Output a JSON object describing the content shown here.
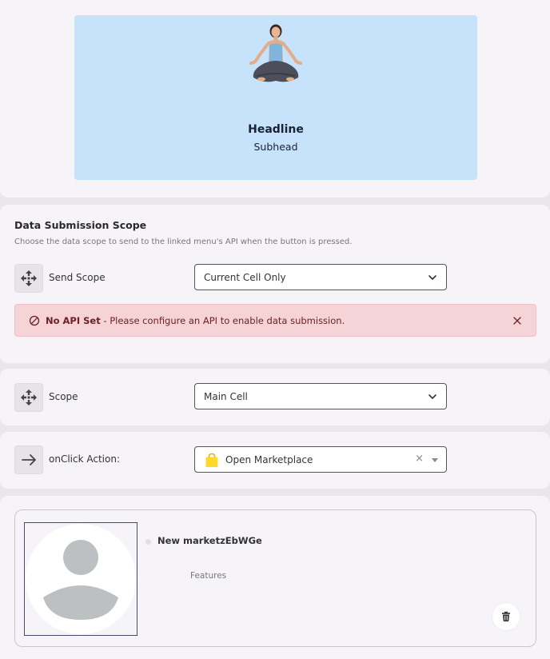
{
  "preview": {
    "headline": "Headline",
    "subhead": "Subhead",
    "background": "#c6e3fb"
  },
  "data_submission": {
    "title": "Data Submission Scope",
    "description": "Choose the data scope to send to the linked menu's API when the button is pressed.",
    "send_scope": {
      "label": "Send Scope",
      "icon": "move-arrows-icon",
      "value": "Current Cell Only"
    },
    "alert": {
      "strong": "No API Set",
      "text": " - Please configure an API to enable data submission.",
      "icon": "ban-icon",
      "color": "#f5d3d6"
    }
  },
  "scope": {
    "label": "Scope",
    "icon": "move-arrows-icon",
    "value": "Main Cell"
  },
  "onclick": {
    "label": "onClick Action:",
    "icon": "arrow-right-icon",
    "value": "Open Marketplace",
    "value_icon": "shopping-bag-icon",
    "clear": "×"
  },
  "marketplace": {
    "name": "New marketzEbWGe",
    "features": "Features",
    "avatar_icon": "user-avatar-icon",
    "delete_icon": "trash-icon"
  }
}
